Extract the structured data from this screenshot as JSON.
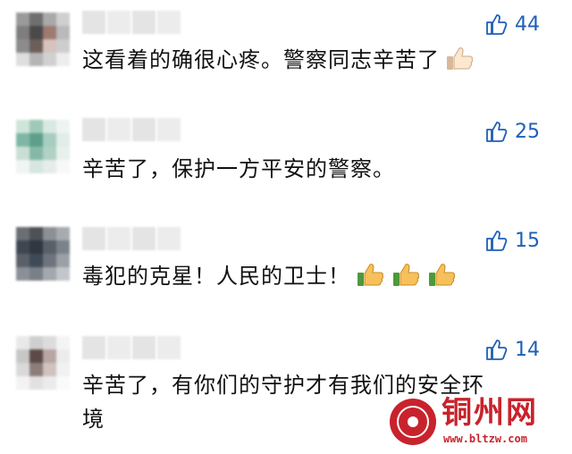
{
  "comments": [
    {
      "likes": "44",
      "text": "这看着的确很心疼。警察同志辛苦了",
      "emoji_count": 1,
      "avatar_colors": [
        "#9a9a9a",
        "#6f6f6f",
        "#a9a9a9",
        "#cfcfcf",
        "#7e7e7e",
        "#4a4a4a",
        "#9e7a70",
        "#b9b9b9",
        "#8c8c8c",
        "#6c5f5a",
        "#d7c3bd",
        "#cdcdcd",
        "#dedede",
        "#b5b5b5",
        "#d0d0d0",
        "#ededed"
      ]
    },
    {
      "likes": "25",
      "text": "辛苦了，保护一方平安的警察。",
      "emoji_count": 0,
      "avatar_colors": [
        "#cfe4da",
        "#9fc9b8",
        "#d8e9e3",
        "#eef4f1",
        "#7fb7a4",
        "#5e9f8b",
        "#a7cdbf",
        "#e2ecea",
        "#c9dfd6",
        "#86b8a8",
        "#b0d1c4",
        "#e7f0ec",
        "#f0f4f3",
        "#d7e6e0",
        "#e6ece9",
        "#f7f9f8"
      ]
    },
    {
      "likes": "15",
      "text": "毒犯的克星！人民的卫士！",
      "emoji_count": 3,
      "avatar_colors": [
        "#6b6f73",
        "#4d5257",
        "#8c9094",
        "#a7abaf",
        "#3f4650",
        "#2f3740",
        "#59606a",
        "#7c828a",
        "#5a6068",
        "#404a56",
        "#6d747d",
        "#9aa0a7",
        "#8b9097",
        "#7a8088",
        "#a3a8ae",
        "#c2c6ca"
      ]
    },
    {
      "likes": "14",
      "text": "辛苦了，有你们的守护才有我们的安全环境",
      "emoji_count": 0,
      "avatar_colors": [
        "#e9e9e9",
        "#cfcfcf",
        "#dcdcdc",
        "#f4f4f4",
        "#c7c7c7",
        "#5c4a48",
        "#b7a6a3",
        "#ececec",
        "#d9d9d9",
        "#8c7d7a",
        "#cfc2bf",
        "#f1f1f1",
        "#f3f3f3",
        "#e1e1e1",
        "#ebebeb",
        "#fafafa"
      ]
    }
  ],
  "watermark": {
    "title": "铜州网",
    "url": "www.bltzw.com",
    "color": "#c8232c"
  },
  "colors": {
    "like_blue": "#1f5fb8",
    "text": "#111111"
  }
}
